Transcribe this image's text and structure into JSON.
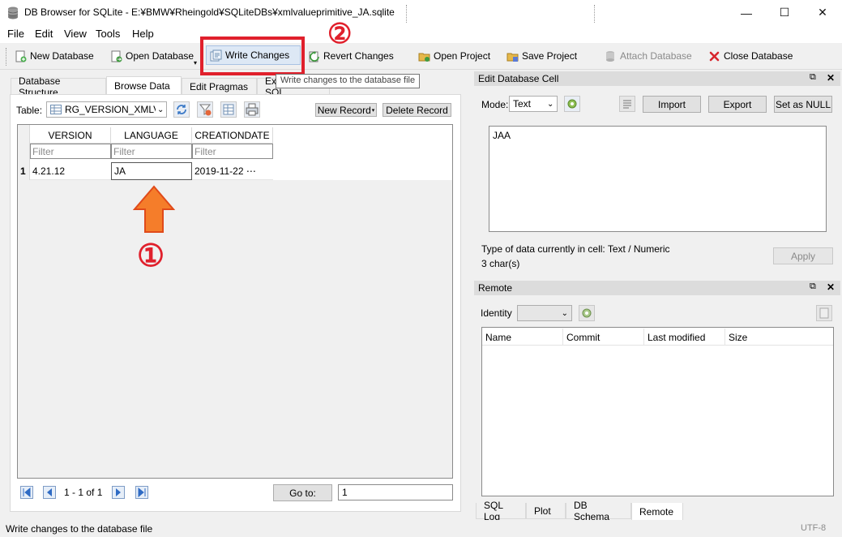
{
  "window": {
    "title": "DB Browser for SQLite - E:¥BMW¥Rheingold¥SQLiteDBs¥xmlvalueprimitive_JA.sqlite",
    "minimize": "—",
    "maximize": "☐",
    "close": "✕"
  },
  "menu": [
    "File",
    "Edit",
    "View",
    "Tools",
    "Help"
  ],
  "toolbar": {
    "new_database": "New Database",
    "open_database": "Open Database",
    "write_changes": "Write Changes",
    "revert_changes": "Revert Changes",
    "open_project": "Open Project",
    "save_project": "Save Project",
    "attach_database": "Attach Database",
    "close_database": "Close Database",
    "tooltip": "Write changes to the database file"
  },
  "annotations": {
    "marker_1": "①",
    "marker_2": "②",
    "arrow_color": "#f57d2a",
    "highlight_color": "#e0202c"
  },
  "tabs": [
    "Database Structure",
    "Browse Data",
    "Edit Pragmas",
    "Execute SQL"
  ],
  "browse": {
    "table_label": "Table:",
    "table_selected": "RG_VERSION_XMLV/",
    "new_record": "New Record",
    "delete_record": "Delete Record",
    "columns": [
      "VERSION",
      "LANGUAGE",
      "CREATIONDATE"
    ],
    "filter_placeholder": "Filter",
    "rows": [
      {
        "num": "1",
        "cells": [
          "4.21.12",
          "JA",
          "2019-11-22 ⋯"
        ]
      }
    ],
    "pager_text": "1 - 1 of 1",
    "goto_label": "Go to:",
    "goto_value": "1"
  },
  "edit_cell": {
    "title": "Edit Database Cell",
    "mode_label": "Mode:",
    "mode_value": "Text",
    "import": "Import",
    "export": "Export",
    "set_null": "Set as NULL",
    "value": "JAA",
    "type_info": "Type of data currently in cell: Text / Numeric",
    "char_count": "3 char(s)",
    "apply": "Apply"
  },
  "remote": {
    "title": "Remote",
    "identity_label": "Identity",
    "columns": [
      "Name",
      "Commit",
      "Last modified",
      "Size"
    ]
  },
  "bottom_tabs": [
    "SQL Log",
    "Plot",
    "DB Schema",
    "Remote"
  ],
  "status": {
    "message": "Write changes to the database file",
    "encoding": "UTF-8"
  }
}
